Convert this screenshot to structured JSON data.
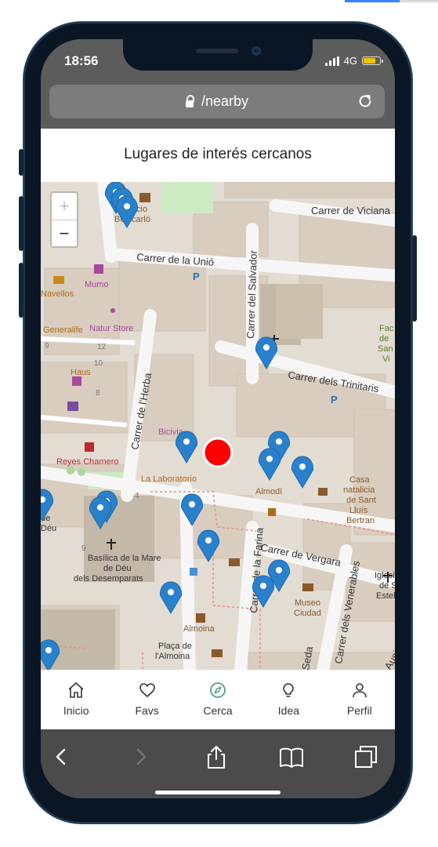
{
  "status": {
    "time": "18:56",
    "network": "4G"
  },
  "browser": {
    "url": "/nearby"
  },
  "page": {
    "title": "Lugares de interés cercanos"
  },
  "map": {
    "zoom_in": "+",
    "zoom_out": "−",
    "streets": {
      "vinana": "Carrer de Viciana",
      "unio": "Carrer de la Unió",
      "salvador": "Carrer del Salvador",
      "trinitaris": "Carrer dels Trinitaris",
      "herba": "Carrer de l'Herba",
      "farina": "Carrer de la Farina",
      "vergara": "Carrer de Vergara",
      "venerables": "Carrer dels Venerables",
      "seda": "Seda",
      "ausias": "Ausiàs Ma"
    },
    "places": {
      "palacio": "Palacio\nBenicarló",
      "navellos": "Navellos",
      "mumo": "Mumo",
      "generalife": "Generalife",
      "natur": "Natur Store",
      "haus": "Haus",
      "bicivia": "Bicivia",
      "reyes": "Reyes Chamero",
      "laboratorio": "La Laboratorio",
      "almodi": "Almodí",
      "casa": "Casa\nnatalicia\nde Sant\nLluís\nBertran",
      "basilica": "Basílica de la Mare\nde Déu\ndels Desemparats",
      "museo": "Museo\nCiudad",
      "almoina": "Almoina",
      "placa": "Plaça de\nl'Almoina",
      "iglesia": "Iglesia\nde Sa\nEsteb",
      "fac": "Fac\nde\nSan\nVi",
      "deu": "de\nDéu"
    },
    "numbers": [
      "4",
      "9",
      "10",
      "12",
      "8",
      "4",
      "9"
    ]
  },
  "tabs": [
    {
      "label": "Inicio",
      "icon": "home-icon"
    },
    {
      "label": "Favs",
      "icon": "heart-icon"
    },
    {
      "label": "Cerca",
      "icon": "compass-icon"
    },
    {
      "label": "Idea",
      "icon": "lightbulb-icon"
    },
    {
      "label": "Perfil",
      "icon": "user-icon"
    }
  ],
  "colors": {
    "accent": "#3a9a6d",
    "marker": "#2a81cb",
    "current_location": "#ff0000"
  }
}
